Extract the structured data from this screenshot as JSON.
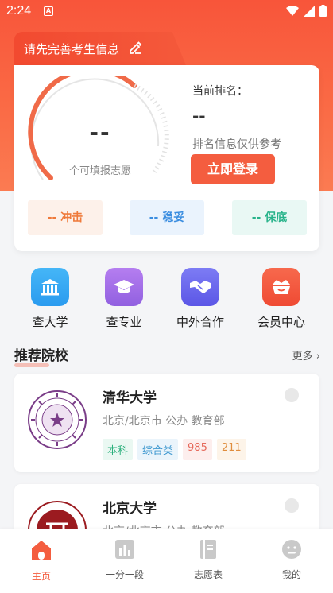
{
  "status_bar": {
    "time": "2:24",
    "notification_glyph": "A"
  },
  "profile_tab": {
    "title": "请先完善考生信息"
  },
  "score_card": {
    "gauge_value": "--",
    "gauge_label": "个可填报志愿",
    "rank_title": "当前排名：",
    "rank_value": "--",
    "rank_note": "排名信息仅供参考",
    "login_label": "立即登录",
    "tags": {
      "chong": "-- 冲击",
      "wen": "-- 稳妥",
      "bao": "-- 保底"
    }
  },
  "quick_links": [
    {
      "label": "查大学",
      "icon": "university-icon",
      "color": "#32a7f2"
    },
    {
      "label": "查专业",
      "icon": "graduation-cap-icon",
      "color": "#a36ee8"
    },
    {
      "label": "中外合作",
      "icon": "handshake-icon",
      "color": "#6e6cf0"
    },
    {
      "label": "会员中心",
      "icon": "crown-basket-icon",
      "color": "#f5553d"
    }
  ],
  "recommend": {
    "title": "推荐院校",
    "more": "更多",
    "universities": [
      {
        "name": "清华大学",
        "meta": "北京/北京市 公办 教育部",
        "tags": [
          "本科",
          "综合类",
          "985",
          "211"
        ]
      },
      {
        "name": "北京大学",
        "meta": "北京/北京市 公办 教育部",
        "tags": []
      }
    ]
  },
  "bottom_nav": [
    {
      "label": "主页",
      "icon": "home-icon",
      "active": true
    },
    {
      "label": "一分一段",
      "icon": "bar-chart-icon",
      "active": false
    },
    {
      "label": "志愿表",
      "icon": "notebook-icon",
      "active": false
    },
    {
      "label": "我的",
      "icon": "profile-face-icon",
      "active": false
    }
  ],
  "colors": {
    "accent": "#f45d3f",
    "hero": "#f8553a"
  }
}
